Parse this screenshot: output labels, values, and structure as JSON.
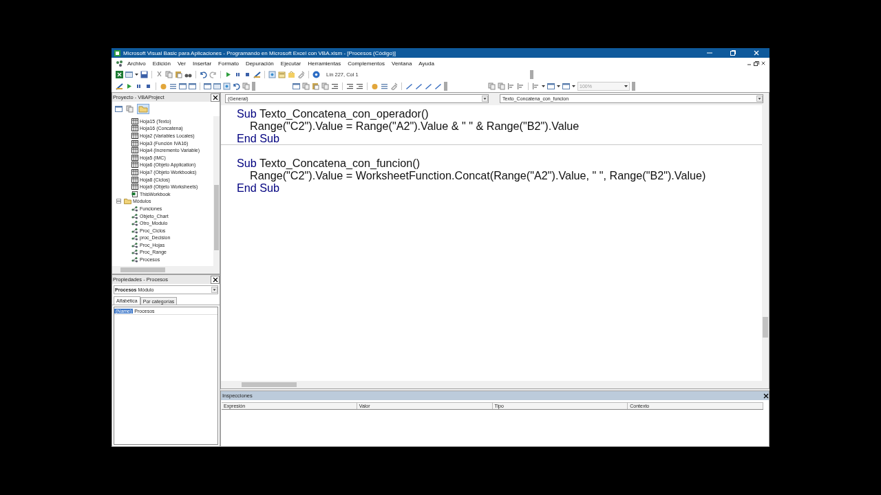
{
  "window": {
    "title": "Microsoft Visual Basic para Aplicaciones - Programando en Microsoft Excel con VBA.xlsm - [Procesos (Código)]"
  },
  "menu": [
    "Archivo",
    "Edición",
    "Ver",
    "Insertar",
    "Formato",
    "Depuración",
    "Ejecutar",
    "Herramientas",
    "Complementos",
    "Ventana",
    "Ayuda"
  ],
  "toolbar": {
    "position": "Lín 227, Col 1",
    "zoom": "100%"
  },
  "project": {
    "title": "Proyecto - VBAProject",
    "tree": [
      {
        "kind": "group",
        "children": [
          {
            "kind": "sheet",
            "label": "Hoja15 (Texto)"
          },
          {
            "kind": "sheet",
            "label": "Hoja16 (Concatena)"
          },
          {
            "kind": "sheet",
            "label": "Hoja2 (Variables Locales)"
          },
          {
            "kind": "sheet",
            "label": "Hoja3 (Función IVA16)"
          },
          {
            "kind": "sheet",
            "label": "Hoja4 (Incremento Variable)"
          },
          {
            "kind": "sheet",
            "label": "Hoja5 (IMC)"
          },
          {
            "kind": "sheet",
            "label": "Hoja6 (Objeto Application)"
          },
          {
            "kind": "sheet",
            "label": "Hoja7 (Objeto Workbooks)"
          },
          {
            "kind": "sheet",
            "label": "Hoja8 (Ciclos)"
          },
          {
            "kind": "sheet",
            "label": "Hoja9 (Objeto Worksheets)"
          },
          {
            "kind": "workbook",
            "label": "ThisWorkbook"
          }
        ]
      },
      {
        "kind": "folder",
        "label": "Módulos",
        "expanded": true,
        "children": [
          {
            "kind": "module",
            "label": "Funciones"
          },
          {
            "kind": "module",
            "label": "Objeto_Chart"
          },
          {
            "kind": "module",
            "label": "Otro_Modulo"
          },
          {
            "kind": "module",
            "label": "Proc_Ciclos"
          },
          {
            "kind": "module",
            "label": "proc_Decision"
          },
          {
            "kind": "module",
            "label": "Proc_Hojas"
          },
          {
            "kind": "module",
            "label": "Proc_Range"
          },
          {
            "kind": "module",
            "label": "Procesos"
          }
        ]
      }
    ]
  },
  "properties": {
    "title": "Propiedades - Procesos",
    "object_name": "Procesos",
    "object_type": "Módulo",
    "tabs": [
      {
        "label": "Alfabética",
        "selected": true
      },
      {
        "label": "Por categorías",
        "selected": false
      }
    ],
    "rows": [
      {
        "name": "(Name)",
        "value": "Procesos",
        "selected": true
      }
    ]
  },
  "code": {
    "object": "(General)",
    "procedure": "Texto_Concatena_con_funcion",
    "procedures": [
      {
        "lines": [
          {
            "indent": false,
            "segments": [
              {
                "kind": "keyword",
                "text": "Sub"
              },
              {
                "kind": "plain",
                "text": " Texto_Concatena_con_operador()"
              }
            ]
          },
          {
            "indent": true,
            "segments": [
              {
                "kind": "plain",
                "text": "Range(\"C2\").Value = Range(\"A2\").Value & \" \" & Range(\"B2\").Value"
              }
            ]
          },
          {
            "indent": false,
            "segments": [
              {
                "kind": "keyword",
                "text": "End Sub"
              }
            ]
          }
        ]
      },
      {
        "lines": [
          {
            "indent": false,
            "segments": [
              {
                "kind": "keyword",
                "text": "Sub"
              },
              {
                "kind": "plain",
                "text": " Texto_Concatena_con_funcion()"
              }
            ]
          },
          {
            "indent": true,
            "segments": [
              {
                "kind": "plain",
                "text": "Range(\"C2\").Value = WorksheetFunction.Concat(Range(\"A2\").Value, \" \", Range(\"B2\").Value)"
              }
            ]
          },
          {
            "indent": false,
            "segments": [
              {
                "kind": "keyword",
                "text": "End Sub"
              }
            ]
          }
        ]
      }
    ]
  },
  "watches": {
    "title": "Inspecciones",
    "columns": [
      "Expresión",
      "Valor",
      "Tipo",
      "Contexto"
    ]
  }
}
